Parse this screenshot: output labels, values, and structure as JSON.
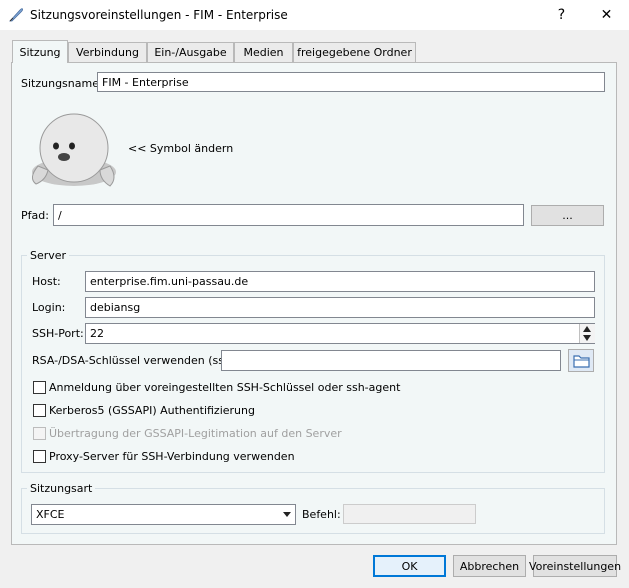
{
  "window": {
    "title": "Sitzungsvoreinstellungen - FIM - Enterprise",
    "help_label": "?",
    "close_label": "✕"
  },
  "tabs": [
    {
      "label": "Sitzung"
    },
    {
      "label": "Verbindung"
    },
    {
      "label": "Ein-/Ausgabe"
    },
    {
      "label": "Medien"
    },
    {
      "label": "freigegebene Ordner"
    }
  ],
  "session": {
    "name_label": "Sitzungsname:",
    "name_value": "FIM - Enterprise",
    "change_icon_label": "<< Symbol ändern",
    "path_label": "Pfad:",
    "path_value": "/",
    "browse_label": "..."
  },
  "server": {
    "legend": "Server",
    "host_label": "Host:",
    "host_value": "enterprise.fim.uni-passau.de",
    "login_label": "Login:",
    "login_value": "debiansg",
    "port_label": "SSH-Port:",
    "port_value": "22",
    "key_label": "RSA-/DSA-Schlüssel verwenden (ssh):",
    "key_value": "",
    "checkboxes": [
      {
        "label": "Anmeldung über voreingestellten SSH-Schlüssel oder ssh-agent"
      },
      {
        "label": "Kerberos5 (GSSAPI) Authentifizierung"
      },
      {
        "label": "Übertragung der GSSAPI-Legitimation auf den Server"
      },
      {
        "label": "Proxy-Server für SSH-Verbindung verwenden"
      }
    ]
  },
  "session_type": {
    "legend": "Sitzungsart",
    "selected": "XFCE",
    "command_label": "Befehl:",
    "command_value": ""
  },
  "buttons": {
    "ok": "OK",
    "cancel": "Abbrechen",
    "defaults": "Voreinstellungen"
  }
}
